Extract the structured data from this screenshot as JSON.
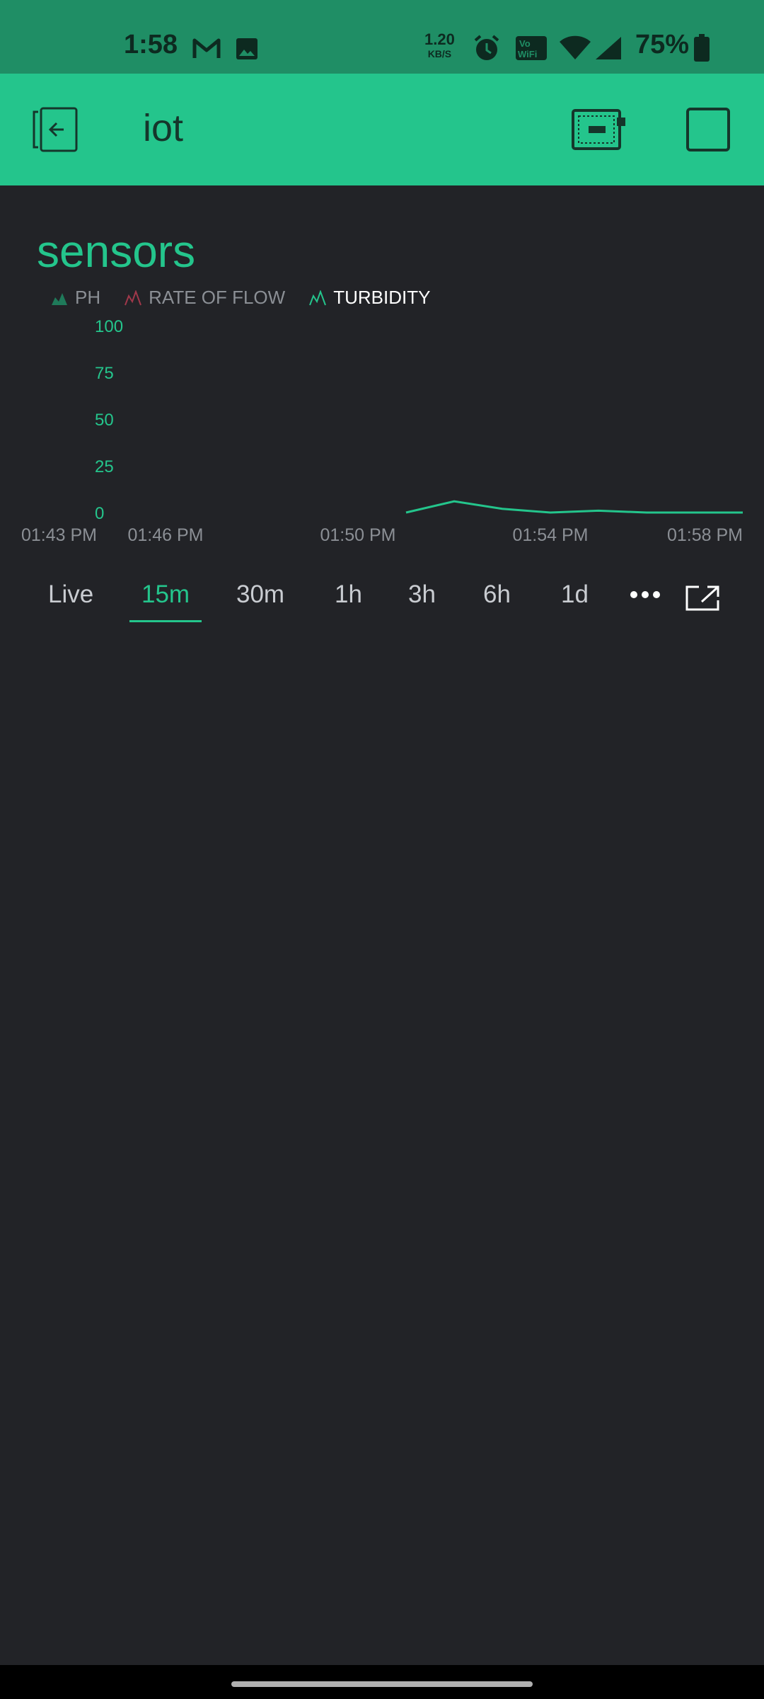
{
  "status_bar": {
    "time": "1:58",
    "net_speed_value": "1.20",
    "net_speed_unit": "KB/S",
    "battery": "75%",
    "icons": [
      "gmail-icon",
      "gallery-icon",
      "alarm-icon",
      "vowifi-icon",
      "wifi-icon",
      "signal-icon",
      "battery-icon"
    ]
  },
  "app_bar": {
    "title": "iot",
    "icons": [
      "exit-icon",
      "device-icon",
      "stop-icon"
    ]
  },
  "widget": {
    "title": "sensors",
    "legend": [
      {
        "label": "PH",
        "color": "#1f7a5a"
      },
      {
        "label": "RATE OF FLOW",
        "color": "#a0384a"
      },
      {
        "label": "TURBIDITY",
        "color": "#24c58c"
      }
    ]
  },
  "chart_data": {
    "type": "line",
    "ylim": [
      0,
      100
    ],
    "yticks": [
      "100",
      "75",
      "50",
      "25",
      "0"
    ],
    "xticks": [
      "01:43 PM",
      "01:46 PM",
      "01:50 PM",
      "01:54 PM",
      "01:58 PM"
    ],
    "series": [
      {
        "name": "TURBIDITY",
        "x": [
          "01:51 PM",
          "01:52 PM",
          "01:53 PM",
          "01:54 PM",
          "01:55 PM",
          "01:56 PM",
          "01:57 PM",
          "01:58 PM"
        ],
        "values": [
          0,
          6,
          2,
          0,
          1,
          0,
          0,
          0
        ]
      }
    ]
  },
  "tabs": {
    "items": [
      "Live",
      "15m",
      "30m",
      "1h",
      "3h",
      "6h",
      "1d"
    ],
    "selected": "15m",
    "more_icon": "more-icon",
    "expand_icon": "expand-icon"
  }
}
